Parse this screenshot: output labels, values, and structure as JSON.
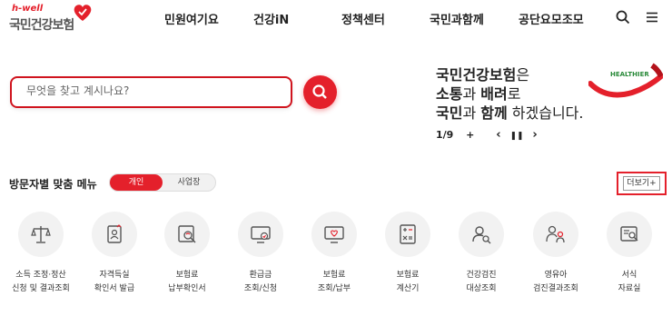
{
  "header": {
    "logo_small": "h-well",
    "logo_main": "국민건강보험",
    "nav": [
      "민원여기요",
      "건강iN",
      "정책센터",
      "국민과함께",
      "공단요모조모"
    ]
  },
  "search": {
    "placeholder": "무엇을 찾고 계시나요?"
  },
  "promo": {
    "line1_bold": "국민건강보험",
    "line1_rest": "은",
    "line2_bold_a": "소통",
    "line2_mid": "과 ",
    "line2_bold_b": "배려",
    "line2_rest": "로",
    "line3_bold_a": "국민",
    "line3_mid": "과 ",
    "line3_bold_b": "함께",
    "line3_rest": " 하겠습니다.",
    "badge_text": "HEALTHIER",
    "slide_counter": "1/9",
    "plus": "+",
    "prev": "‹",
    "pause": "❚❚",
    "next": "›"
  },
  "menu_section": {
    "title": "방문자별 맞춤 메뉴",
    "toggle": [
      "개인",
      "사업장"
    ],
    "more_label": "더보기+",
    "items": [
      {
        "line1": "소득 조정·정산",
        "line2": "신청 및 결과조회",
        "icon": "scale-icon"
      },
      {
        "line1": "자격득실",
        "line2": "확인서 발급",
        "icon": "certificate-icon"
      },
      {
        "line1": "보험료",
        "line2": "납부확인서",
        "icon": "receipt-search-icon"
      },
      {
        "line1": "환급금",
        "line2": "조회/신청",
        "icon": "monitor-refund-icon"
      },
      {
        "line1": "보험료",
        "line2": "조회/납부",
        "icon": "monitor-heart-icon"
      },
      {
        "line1": "보험료",
        "line2": "계산기",
        "icon": "calculator-icon"
      },
      {
        "line1": "건강검진",
        "line2": "대상조회",
        "icon": "user-search-icon"
      },
      {
        "line1": "영유아",
        "line2": "검진결과조회",
        "icon": "parent-child-icon"
      },
      {
        "line1": "서식",
        "line2": "자료실",
        "icon": "document-search-icon"
      }
    ]
  },
  "colors": {
    "accent": "#e4202b",
    "icon_bg": "#f2f2f2"
  }
}
